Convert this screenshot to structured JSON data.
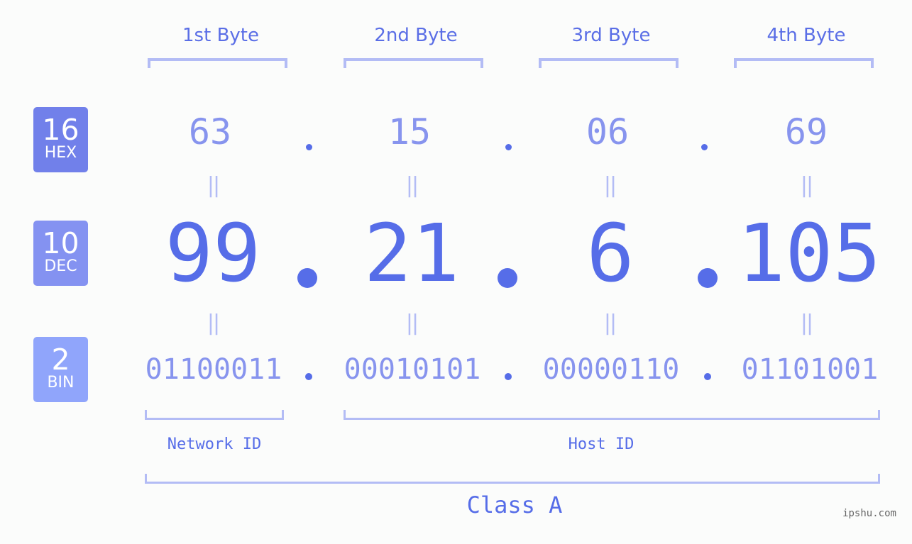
{
  "colors": {
    "background": "#fbfcfb",
    "accent": "#566de8",
    "hex_badge": "#7180ea",
    "dec_badge": "#8492f1",
    "bin_badge": "#90a5fb",
    "bracket": "#b3bcf5",
    "light_value": "#8794ee"
  },
  "badges": [
    {
      "number": "16",
      "label": "HEX"
    },
    {
      "number": "10",
      "label": "DEC"
    },
    {
      "number": "2",
      "label": "BIN"
    }
  ],
  "byte_headers": [
    "1st Byte",
    "2nd Byte",
    "3rd Byte",
    "4th Byte"
  ],
  "hex_values": [
    "63",
    "15",
    "06",
    "69"
  ],
  "dec_values": [
    "99",
    "21",
    "6",
    "105"
  ],
  "bin_values": [
    "01100011",
    "00010101",
    "00000110",
    "01101001"
  ],
  "separator": ".",
  "equals_sign": "||",
  "network_id_label": "Network ID",
  "host_id_label": "Host ID",
  "class_label": "Class A",
  "watermark": "ipshu.com"
}
